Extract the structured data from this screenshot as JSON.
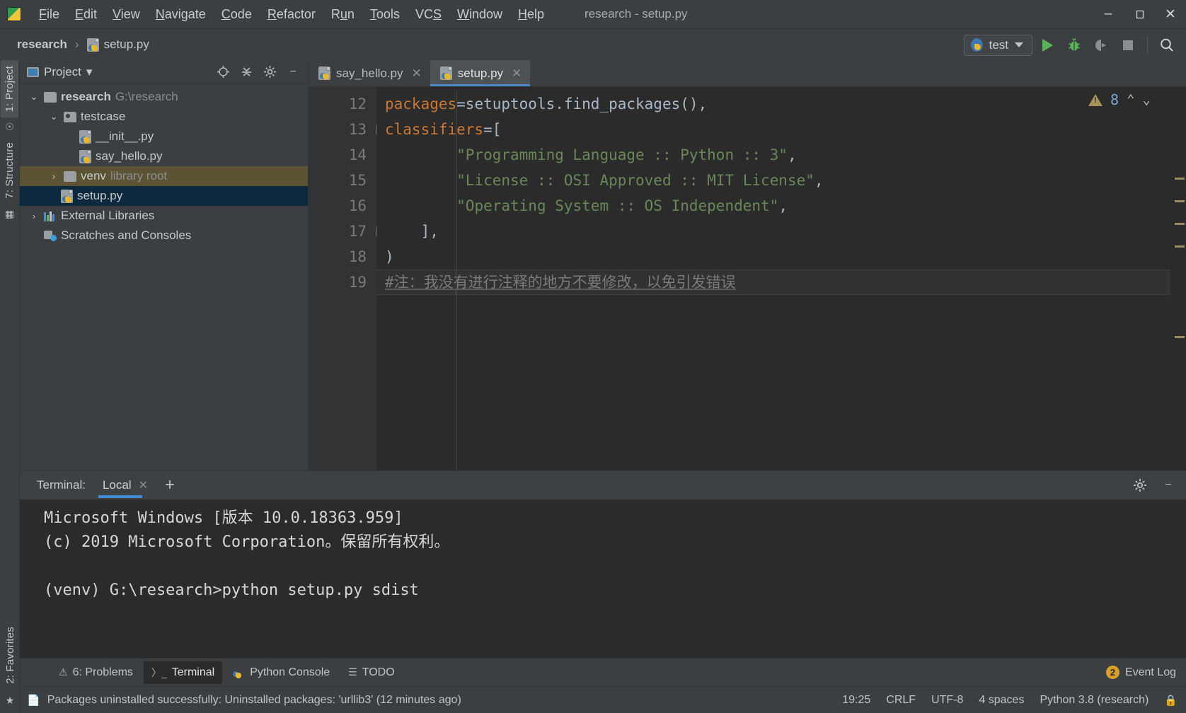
{
  "titlebar": {
    "logo_icon": "pycharm-logo-icon",
    "menu": [
      {
        "label": "File",
        "mnemonic": "F"
      },
      {
        "label": "Edit",
        "mnemonic": "E"
      },
      {
        "label": "View",
        "mnemonic": "V"
      },
      {
        "label": "Navigate",
        "mnemonic": "N"
      },
      {
        "label": "Code",
        "mnemonic": "C"
      },
      {
        "label": "Refactor",
        "mnemonic": "R"
      },
      {
        "label": "Run",
        "mnemonic": "u"
      },
      {
        "label": "Tools",
        "mnemonic": "T"
      },
      {
        "label": "VCS",
        "mnemonic": "S"
      },
      {
        "label": "Window",
        "mnemonic": "W"
      },
      {
        "label": "Help",
        "mnemonic": "H"
      }
    ],
    "window_title": "research - setup.py",
    "controls": {
      "minimize": "–",
      "maximize": "❐",
      "close": "✕"
    }
  },
  "navbar": {
    "breadcrumb": {
      "project": "research",
      "separator": "›",
      "file": "setup.py"
    },
    "run_config": {
      "name": "test",
      "icon": "python-icon"
    },
    "buttons": {
      "run": "run-button",
      "debug": "debug-button",
      "coverage": "run-with-coverage-button",
      "stop": "stop-button",
      "search": "search-everywhere-button"
    }
  },
  "left_strip": {
    "project_tab": "1: Project",
    "project_tab_num": "1",
    "structure_tab": "7: Structure",
    "structure_tab_num": "7",
    "favorites_tab": "2: Favorites",
    "favorites_tab_num": "2"
  },
  "project_panel": {
    "title": "Project",
    "caret": "▾",
    "actions": [
      "locate-icon",
      "collapse-all-icon",
      "gear-icon",
      "hide-icon"
    ],
    "tree": [
      {
        "label": "research",
        "hint": "G:\\research",
        "icon": "folder-icon",
        "arrow": "⌄",
        "indent": 0,
        "state": "normal",
        "bold": true
      },
      {
        "label": "testcase",
        "hint": "",
        "icon": "source-folder-icon",
        "arrow": "⌄",
        "indent": 1,
        "state": "normal",
        "bold": false
      },
      {
        "label": "__init__.py",
        "hint": "",
        "icon": "python-file-icon",
        "arrow": "",
        "indent": 2,
        "state": "normal",
        "bold": false
      },
      {
        "label": "say_hello.py",
        "hint": "",
        "icon": "python-file-icon",
        "arrow": "",
        "indent": 2,
        "state": "normal",
        "bold": false
      },
      {
        "label": "venv",
        "hint": "library root",
        "icon": "folder-icon",
        "arrow": "›",
        "indent": 1,
        "state": "hovered",
        "bold": false
      },
      {
        "label": "setup.py",
        "hint": "",
        "icon": "python-file-icon",
        "arrow": "",
        "indent": 1,
        "state": "selected",
        "bold": false
      },
      {
        "label": "External Libraries",
        "hint": "",
        "icon": "libraries-icon",
        "arrow": "›",
        "indent": 0,
        "state": "normal",
        "bold": false
      },
      {
        "label": "Scratches and Consoles",
        "hint": "",
        "icon": "scratches-icon",
        "arrow": "",
        "indent": 0,
        "state": "normal",
        "bold": false
      }
    ]
  },
  "editor": {
    "tabs": [
      {
        "label": "say_hello.py",
        "icon": "python-file-icon",
        "close": "✕",
        "active": false
      },
      {
        "label": "setup.py",
        "icon": "python-file-icon",
        "close": "✕",
        "active": true
      }
    ],
    "lines": [
      {
        "num": "12",
        "fold": "",
        "current": false,
        "tokens": [
          {
            "t": "    ",
            "c": "k-plain"
          },
          {
            "t": "packages",
            "c": "k-arg"
          },
          {
            "t": "=setuptools.find_packages(),",
            "c": "k-plain"
          }
        ]
      },
      {
        "num": "13",
        "fold": "−",
        "current": false,
        "tokens": [
          {
            "t": "    ",
            "c": "k-plain"
          },
          {
            "t": "classifiers",
            "c": "k-arg"
          },
          {
            "t": "=[",
            "c": "k-plain"
          }
        ]
      },
      {
        "num": "14",
        "fold": "",
        "current": false,
        "tokens": [
          {
            "t": "        ",
            "c": "k-plain"
          },
          {
            "t": "\"Programming Language :: Python :: 3\"",
            "c": "k-str"
          },
          {
            "t": ",",
            "c": "k-plain"
          }
        ]
      },
      {
        "num": "15",
        "fold": "",
        "current": false,
        "tokens": [
          {
            "t": "        ",
            "c": "k-plain"
          },
          {
            "t": "\"License :: OSI Approved :: MIT License\"",
            "c": "k-str"
          },
          {
            "t": ",",
            "c": "k-plain"
          }
        ]
      },
      {
        "num": "16",
        "fold": "",
        "current": false,
        "tokens": [
          {
            "t": "        ",
            "c": "k-plain"
          },
          {
            "t": "\"Operating System :: OS Independent\"",
            "c": "k-str"
          },
          {
            "t": ",",
            "c": "k-plain"
          }
        ]
      },
      {
        "num": "17",
        "fold": "−",
        "current": false,
        "tokens": [
          {
            "t": "    ],",
            "c": "k-plain"
          }
        ]
      },
      {
        "num": "18",
        "fold": "",
        "current": false,
        "tokens": [
          {
            "t": ")",
            "c": "k-plain"
          }
        ]
      },
      {
        "num": "19",
        "fold": "",
        "current": true,
        "tokens": [
          {
            "t": "#注：我没有进行注释的地方不要修改，以免引发错误",
            "c": "k-comment"
          }
        ]
      }
    ],
    "inspection": {
      "warning_icon": "warning-triangle-icon",
      "count": "8",
      "prev": "⌃",
      "next": "⌄"
    }
  },
  "terminal": {
    "label": "Terminal:",
    "tab_name": "Local",
    "tab_close": "✕",
    "add_tab": "+",
    "settings_icon": "gear-icon",
    "hide_icon": "hide-icon",
    "lines": [
      "Microsoft Windows [版本 10.0.18363.959]",
      "(c) 2019 Microsoft Corporation。保留所有权利。",
      "",
      "(venv) G:\\research>python setup.py sdist"
    ]
  },
  "bottom_tabs": [
    {
      "label": "6: Problems",
      "icon": "problems-icon",
      "active": false
    },
    {
      "label": "Terminal",
      "icon": "terminal-icon",
      "active": true
    },
    {
      "label": "Python Console",
      "icon": "python-icon",
      "active": false
    },
    {
      "label": "TODO",
      "icon": "todo-icon",
      "active": false
    }
  ],
  "event_log": {
    "label": "Event Log",
    "count": "2"
  },
  "statusbar": {
    "message": "Packages uninstalled successfully: Uninstalled packages: 'urllib3' (12 minutes ago)",
    "message_icon": "notification-icon",
    "time": "19:25",
    "line_separator": "CRLF",
    "encoding": "UTF-8",
    "indent": "4 spaces",
    "interpreter": "Python 3.8 (research)",
    "lock_icon": "lock-icon"
  },
  "colors": {
    "accent_blue": "#3f8ad0",
    "run_green": "#5ab55a",
    "warn_amber": "#a9935c",
    "selection_blue": "#0d293e",
    "hover_olive": "#5c5335",
    "string_green": "#6a8759",
    "keyword_orange": "#cb7832"
  }
}
